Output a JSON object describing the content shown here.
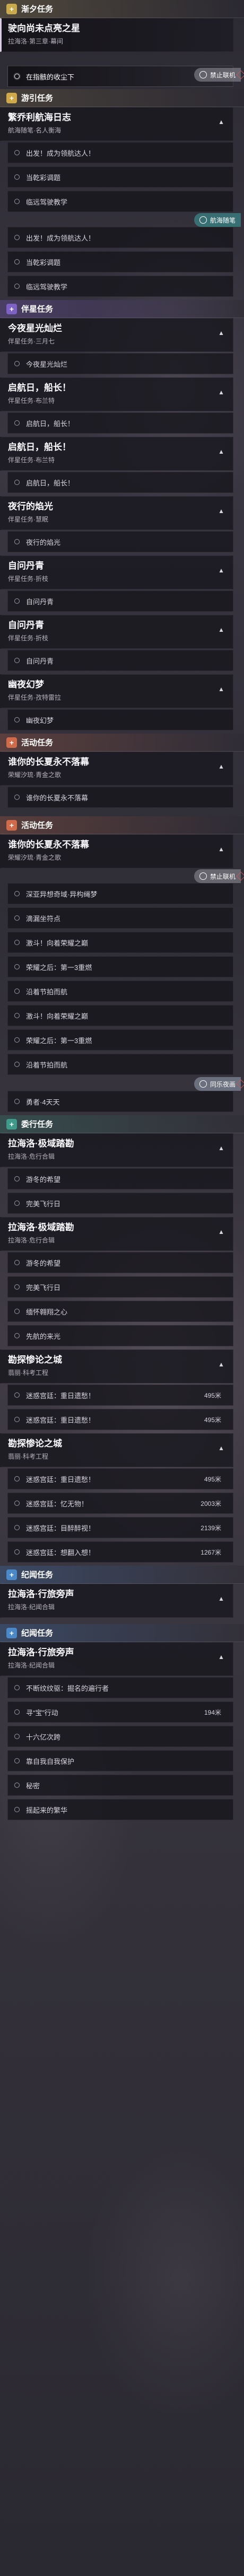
{
  "sections": [
    {
      "label": "渐夕任务",
      "badge": "+",
      "color": "#c8a94b",
      "bg": "rgba(160,140,80,0.30)"
    },
    {
      "label": "游引任务",
      "badge": "+",
      "color": "#cfa84a",
      "bg": "rgba(150,130,70,0.22)"
    },
    {
      "label": "伴星任务",
      "badge": "+",
      "color": "#7d62c4",
      "bg": "rgba(120,90,190,0.30)"
    },
    {
      "label": "活动任务",
      "badge": "+",
      "color": "#cf6b4a",
      "bg": "rgba(190,100,70,0.28)"
    },
    {
      "label": "活动任务",
      "badge": "+",
      "color": "#cf6b4a",
      "bg": "rgba(190,100,70,0.28)"
    },
    {
      "label": "委行任务",
      "badge": "+",
      "color": "#3f9a8a",
      "bg": "rgba(50,140,120,0.28)"
    },
    {
      "label": "纪闻任务",
      "badge": "+",
      "color": "#4b88c8",
      "bg": "rgba(60,120,190,0.28)"
    },
    {
      "label": "纪闻任务",
      "badge": "+",
      "color": "#4b88c8",
      "bg": "rgba(60,120,190,0.28)"
    }
  ],
  "quests": [
    {
      "title": "驶向尚未点亮之星",
      "subtitle": "拉海洛·第三章·幕间"
    },
    {
      "title": "繁乔利航海日志",
      "subtitle": "航海随笔·名人衡海"
    },
    {
      "title": "今夜星光灿烂",
      "subtitle": "伴星任务·三月七"
    },
    {
      "title": "启航日，船长！",
      "subtitle": "伴星任务·布兰特"
    },
    {
      "title": "启航日，船长！",
      "subtitle": "伴星任务·布兰特"
    },
    {
      "title": "夜行的焰光",
      "subtitle": "伴星任务·慧眠"
    },
    {
      "title": "自问丹青",
      "subtitle": "伴星任务·折枝"
    },
    {
      "title": "自问丹青",
      "subtitle": "伴星任务·折枝"
    },
    {
      "title": "幽夜幻梦",
      "subtitle": "伴星任务·孜特雷拉"
    },
    {
      "title": "谁你的长夏永不落幕",
      "subtitle": "荣耀汐琉·青金之歌"
    },
    {
      "title": "谁你的长夏永不落幕",
      "subtitle": "荣耀汐琉·青金之歌"
    },
    {
      "title": "拉海洛·极域踏勘",
      "subtitle": "拉海洛·危行合辑"
    },
    {
      "title": "拉海洛·极域踏勘",
      "subtitle": "拉海洛·危行合辑"
    },
    {
      "title": "勘探惨论之城",
      "subtitle": "翡丽·科考工程"
    },
    {
      "title": "勘探惨论之城",
      "subtitle": "翡丽·科考工程"
    },
    {
      "title": "拉海洛·行旅旁声",
      "subtitle": "拉海洛·纪闻合辑"
    },
    {
      "title": "拉海洛·行旅旁声",
      "subtitle": "拉海洛·纪闻合辑"
    }
  ],
  "subtasks": [
    {
      "label": "在指骸的收尘下",
      "dist": ""
    },
    {
      "label": "出发！成为领航达人！",
      "dist": ""
    },
    {
      "label": "当乾彩调题",
      "dist": ""
    },
    {
      "label": "临远驾驶教学",
      "dist": ""
    },
    {
      "label": "出发！成为领航达人！",
      "dist": ""
    },
    {
      "label": "当乾彩调题",
      "dist": ""
    },
    {
      "label": "临远驾驶教学",
      "dist": ""
    },
    {
      "label": "今夜星光灿烂",
      "dist": ""
    },
    {
      "label": "启航日，船长！",
      "dist": ""
    },
    {
      "label": "启航日，船长！",
      "dist": ""
    },
    {
      "label": "夜行的焰光",
      "dist": ""
    },
    {
      "label": "自问丹青",
      "dist": ""
    },
    {
      "label": "自问丹青",
      "dist": ""
    },
    {
      "label": "幽夜幻梦",
      "dist": ""
    },
    {
      "label": "谁你的长夏永不落幕",
      "dist": ""
    },
    {
      "label": "深亚异想奇域·异构绳梦",
      "dist": ""
    },
    {
      "label": "滴漏坐符点",
      "dist": ""
    },
    {
      "label": "激斗！向着荣耀之巅",
      "dist": ""
    },
    {
      "label": "荣耀之后：第一3重燃",
      "dist": ""
    },
    {
      "label": "沿着节拍而航",
      "dist": ""
    },
    {
      "label": "激斗！向着荣耀之巅",
      "dist": ""
    },
    {
      "label": "荣耀之后：第一3重燃",
      "dist": ""
    },
    {
      "label": "沿着节拍而航",
      "dist": ""
    },
    {
      "label": "勇者·4天天",
      "dist": ""
    },
    {
      "label": "游冬的希望",
      "dist": ""
    },
    {
      "label": "完美飞行日",
      "dist": ""
    },
    {
      "label": "游冬的希望",
      "dist": ""
    },
    {
      "label": "完美飞行日",
      "dist": ""
    },
    {
      "label": "缅怀翱翔之心",
      "dist": ""
    },
    {
      "label": "先航的来光",
      "dist": ""
    },
    {
      "label": "迷惑宫廷：重日遗愁！",
      "dist": "495米"
    },
    {
      "label": "迷惑宫廷：重日遗愁！",
      "dist": "495米"
    },
    {
      "label": "迷惑宫廷：重日遗愁！",
      "dist": "495米"
    },
    {
      "label": "迷惑宫廷：忆无物！",
      "dist": "2003米"
    },
    {
      "label": "迷惑宫廷：目醉醉视！",
      "dist": "2139米"
    },
    {
      "label": "迷惑宫廷：想翻入想！",
      "dist": "1267米"
    },
    {
      "label": "不断纹纹驱：掘名的遍行者",
      "dist": ""
    },
    {
      "label": "寻“宝”行动",
      "dist": "194米"
    },
    {
      "label": "十六亿次跨",
      "dist": ""
    },
    {
      "label": "靠自我自我保护",
      "dist": ""
    },
    {
      "label": "秘密",
      "dist": ""
    },
    {
      "label": "摇起来的繁华",
      "dist": ""
    }
  ],
  "tags": [
    {
      "label": "禁止联机",
      "style": "grey"
    },
    {
      "label": "航海随笔",
      "style": "teal"
    },
    {
      "label": "禁止联机",
      "style": "grey"
    },
    {
      "label": "同乐夜画",
      "style": "blue"
    }
  ]
}
